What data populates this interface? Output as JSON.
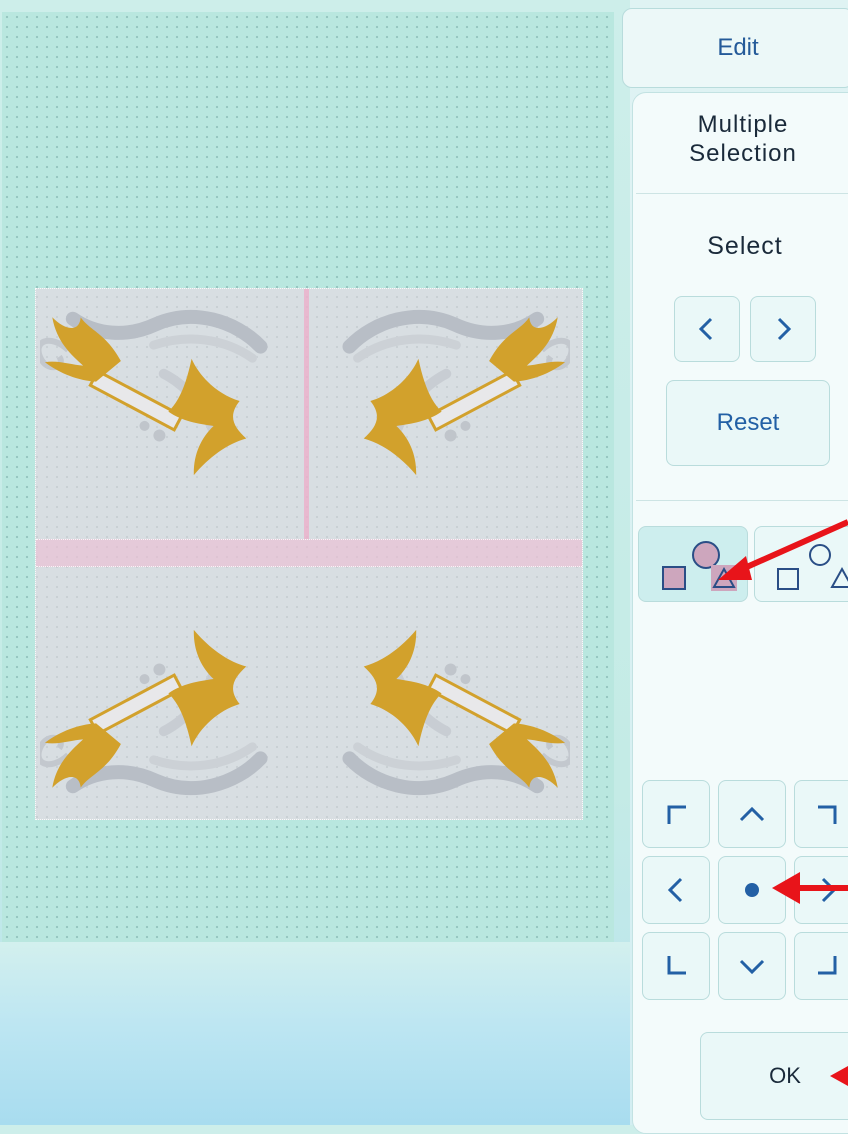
{
  "panel": {
    "tab_label": "Edit",
    "title_line1": "Multiple",
    "title_line2": "Selection",
    "select_label": "Select",
    "prev_icon": "chevron-left-icon",
    "next_icon": "chevron-right-icon",
    "reset_label": "Reset",
    "selection_modes": [
      {
        "name": "select-all-grouped",
        "icon": "square-circle-triangle-filled-icon",
        "active": true
      },
      {
        "name": "select-individual",
        "icon": "square-circle-triangle-outline-icon",
        "active": false
      }
    ],
    "move_pad": [
      "corner-top-left",
      "up",
      "corner-top-right",
      "left",
      "center",
      "right",
      "corner-bottom-left",
      "down",
      "corner-bottom-right"
    ],
    "ok_label": "OK"
  },
  "colors": {
    "accent": "#2360a5",
    "gold_embroidery": "#d2a12c",
    "silver_embroidery": "#b8bec6",
    "annotation_arrow": "#e8141a",
    "hoop_tint": "#f2d7e4"
  }
}
